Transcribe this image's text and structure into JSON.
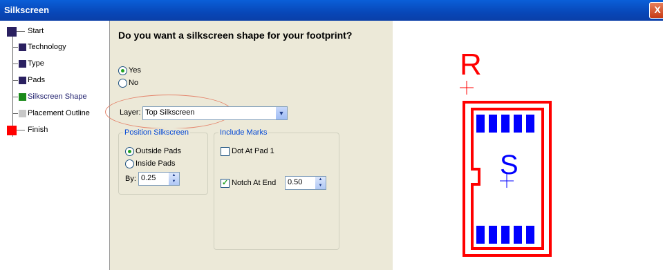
{
  "window": {
    "title": "Silkscreen",
    "close_label": "X"
  },
  "steps": [
    {
      "label": "Start"
    },
    {
      "label": "Technology"
    },
    {
      "label": "Type"
    },
    {
      "label": "Pads"
    },
    {
      "label": "Silkscreen Shape"
    },
    {
      "label": "Placement Outline"
    },
    {
      "label": "Finish"
    }
  ],
  "colors": {
    "step_done": "#2a2060",
    "step_current": "#1a8a1a",
    "step_pending": "#c8c8c8",
    "finish": "#ff0000",
    "silkscreen": "#ff0000",
    "pads": "#0000ff"
  },
  "wizard": {
    "question": "Do you want a silkscreen shape for your footprint?",
    "yes_label": "Yes",
    "no_label": "No",
    "layer_label": "Layer:",
    "layer_value": "Top Silkscreen",
    "position_title": "Position Silkscreen",
    "outside_label": "Outside Pads",
    "inside_label": "Inside Pads",
    "by_label": "By:",
    "by_value": "0.25",
    "marks_title": "Include Marks",
    "dot_label": "Dot At Pad 1",
    "notch_label": "Notch At End",
    "notch_value": "0.50"
  },
  "preview": {
    "ref_label": "R",
    "center_label": "S"
  }
}
